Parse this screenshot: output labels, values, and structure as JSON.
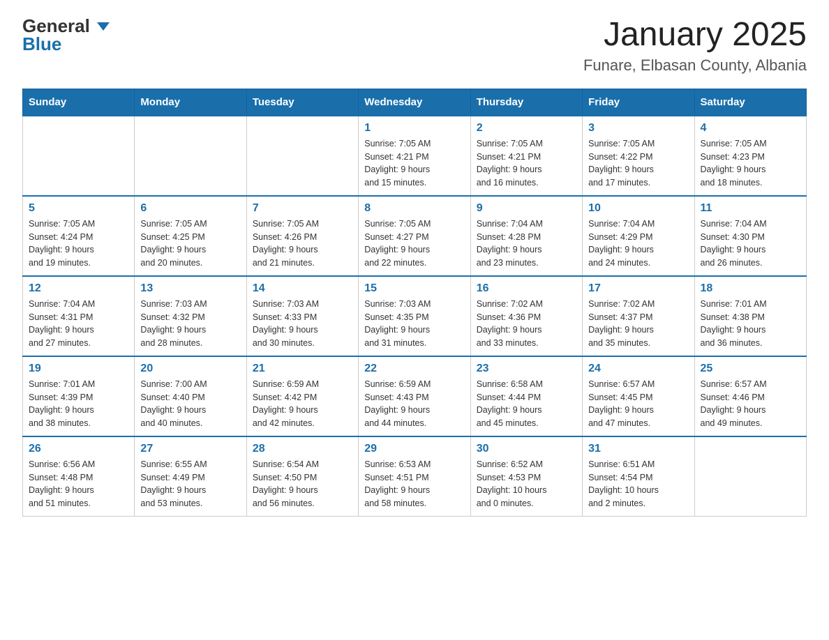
{
  "logo": {
    "general": "General",
    "blue": "Blue"
  },
  "title": "January 2025",
  "subtitle": "Funare, Elbasan County, Albania",
  "days_of_week": [
    "Sunday",
    "Monday",
    "Tuesday",
    "Wednesday",
    "Thursday",
    "Friday",
    "Saturday"
  ],
  "weeks": [
    [
      {
        "day": "",
        "info": ""
      },
      {
        "day": "",
        "info": ""
      },
      {
        "day": "",
        "info": ""
      },
      {
        "day": "1",
        "info": "Sunrise: 7:05 AM\nSunset: 4:21 PM\nDaylight: 9 hours\nand 15 minutes."
      },
      {
        "day": "2",
        "info": "Sunrise: 7:05 AM\nSunset: 4:21 PM\nDaylight: 9 hours\nand 16 minutes."
      },
      {
        "day": "3",
        "info": "Sunrise: 7:05 AM\nSunset: 4:22 PM\nDaylight: 9 hours\nand 17 minutes."
      },
      {
        "day": "4",
        "info": "Sunrise: 7:05 AM\nSunset: 4:23 PM\nDaylight: 9 hours\nand 18 minutes."
      }
    ],
    [
      {
        "day": "5",
        "info": "Sunrise: 7:05 AM\nSunset: 4:24 PM\nDaylight: 9 hours\nand 19 minutes."
      },
      {
        "day": "6",
        "info": "Sunrise: 7:05 AM\nSunset: 4:25 PM\nDaylight: 9 hours\nand 20 minutes."
      },
      {
        "day": "7",
        "info": "Sunrise: 7:05 AM\nSunset: 4:26 PM\nDaylight: 9 hours\nand 21 minutes."
      },
      {
        "day": "8",
        "info": "Sunrise: 7:05 AM\nSunset: 4:27 PM\nDaylight: 9 hours\nand 22 minutes."
      },
      {
        "day": "9",
        "info": "Sunrise: 7:04 AM\nSunset: 4:28 PM\nDaylight: 9 hours\nand 23 minutes."
      },
      {
        "day": "10",
        "info": "Sunrise: 7:04 AM\nSunset: 4:29 PM\nDaylight: 9 hours\nand 24 minutes."
      },
      {
        "day": "11",
        "info": "Sunrise: 7:04 AM\nSunset: 4:30 PM\nDaylight: 9 hours\nand 26 minutes."
      }
    ],
    [
      {
        "day": "12",
        "info": "Sunrise: 7:04 AM\nSunset: 4:31 PM\nDaylight: 9 hours\nand 27 minutes."
      },
      {
        "day": "13",
        "info": "Sunrise: 7:03 AM\nSunset: 4:32 PM\nDaylight: 9 hours\nand 28 minutes."
      },
      {
        "day": "14",
        "info": "Sunrise: 7:03 AM\nSunset: 4:33 PM\nDaylight: 9 hours\nand 30 minutes."
      },
      {
        "day": "15",
        "info": "Sunrise: 7:03 AM\nSunset: 4:35 PM\nDaylight: 9 hours\nand 31 minutes."
      },
      {
        "day": "16",
        "info": "Sunrise: 7:02 AM\nSunset: 4:36 PM\nDaylight: 9 hours\nand 33 minutes."
      },
      {
        "day": "17",
        "info": "Sunrise: 7:02 AM\nSunset: 4:37 PM\nDaylight: 9 hours\nand 35 minutes."
      },
      {
        "day": "18",
        "info": "Sunrise: 7:01 AM\nSunset: 4:38 PM\nDaylight: 9 hours\nand 36 minutes."
      }
    ],
    [
      {
        "day": "19",
        "info": "Sunrise: 7:01 AM\nSunset: 4:39 PM\nDaylight: 9 hours\nand 38 minutes."
      },
      {
        "day": "20",
        "info": "Sunrise: 7:00 AM\nSunset: 4:40 PM\nDaylight: 9 hours\nand 40 minutes."
      },
      {
        "day": "21",
        "info": "Sunrise: 6:59 AM\nSunset: 4:42 PM\nDaylight: 9 hours\nand 42 minutes."
      },
      {
        "day": "22",
        "info": "Sunrise: 6:59 AM\nSunset: 4:43 PM\nDaylight: 9 hours\nand 44 minutes."
      },
      {
        "day": "23",
        "info": "Sunrise: 6:58 AM\nSunset: 4:44 PM\nDaylight: 9 hours\nand 45 minutes."
      },
      {
        "day": "24",
        "info": "Sunrise: 6:57 AM\nSunset: 4:45 PM\nDaylight: 9 hours\nand 47 minutes."
      },
      {
        "day": "25",
        "info": "Sunrise: 6:57 AM\nSunset: 4:46 PM\nDaylight: 9 hours\nand 49 minutes."
      }
    ],
    [
      {
        "day": "26",
        "info": "Sunrise: 6:56 AM\nSunset: 4:48 PM\nDaylight: 9 hours\nand 51 minutes."
      },
      {
        "day": "27",
        "info": "Sunrise: 6:55 AM\nSunset: 4:49 PM\nDaylight: 9 hours\nand 53 minutes."
      },
      {
        "day": "28",
        "info": "Sunrise: 6:54 AM\nSunset: 4:50 PM\nDaylight: 9 hours\nand 56 minutes."
      },
      {
        "day": "29",
        "info": "Sunrise: 6:53 AM\nSunset: 4:51 PM\nDaylight: 9 hours\nand 58 minutes."
      },
      {
        "day": "30",
        "info": "Sunrise: 6:52 AM\nSunset: 4:53 PM\nDaylight: 10 hours\nand 0 minutes."
      },
      {
        "day": "31",
        "info": "Sunrise: 6:51 AM\nSunset: 4:54 PM\nDaylight: 10 hours\nand 2 minutes."
      },
      {
        "day": "",
        "info": ""
      }
    ]
  ]
}
